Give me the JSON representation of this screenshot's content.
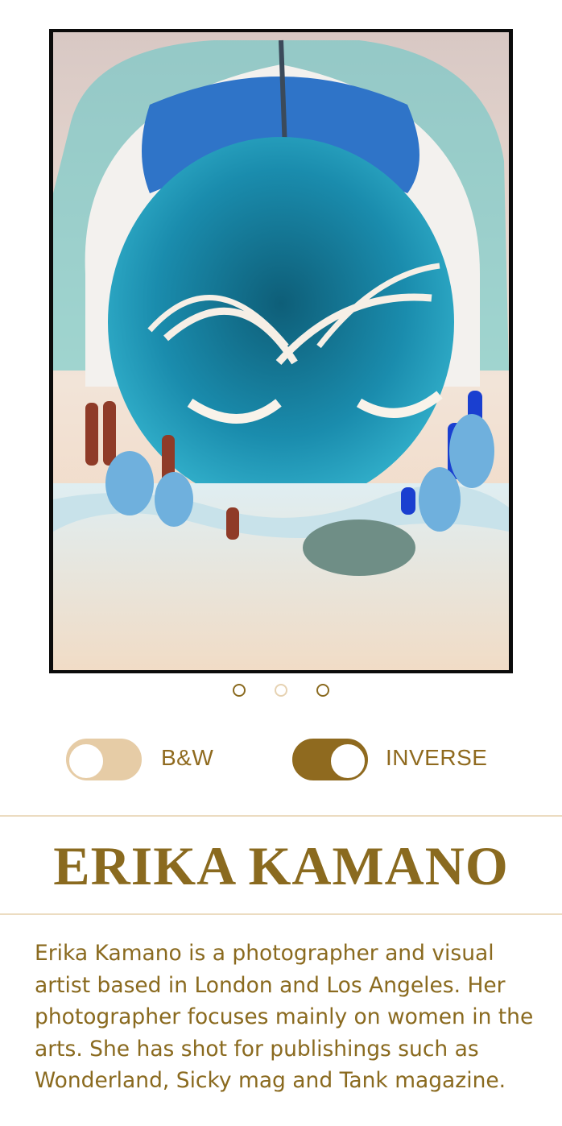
{
  "photo": {
    "subject": "inverted color portrait"
  },
  "carousel": {
    "dots": [
      "active",
      "inactive",
      "active"
    ]
  },
  "filters": {
    "bw": {
      "label": "B&W",
      "on": false
    },
    "inverse": {
      "label": "INVERSE",
      "on": true
    }
  },
  "artist": {
    "name": "ERIKA KAMANO",
    "bio": "Erika Kamano is a photographer and visual artist based in London and Los Angeles. Her photographer focuses mainly on women in the arts. She has shot for publishings such as Wonderland, Sicky mag and Tank magazine."
  },
  "colors": {
    "accent": "#8a6a1f",
    "accent_light": "#e6cca6",
    "rule": "#ecdcc1"
  }
}
